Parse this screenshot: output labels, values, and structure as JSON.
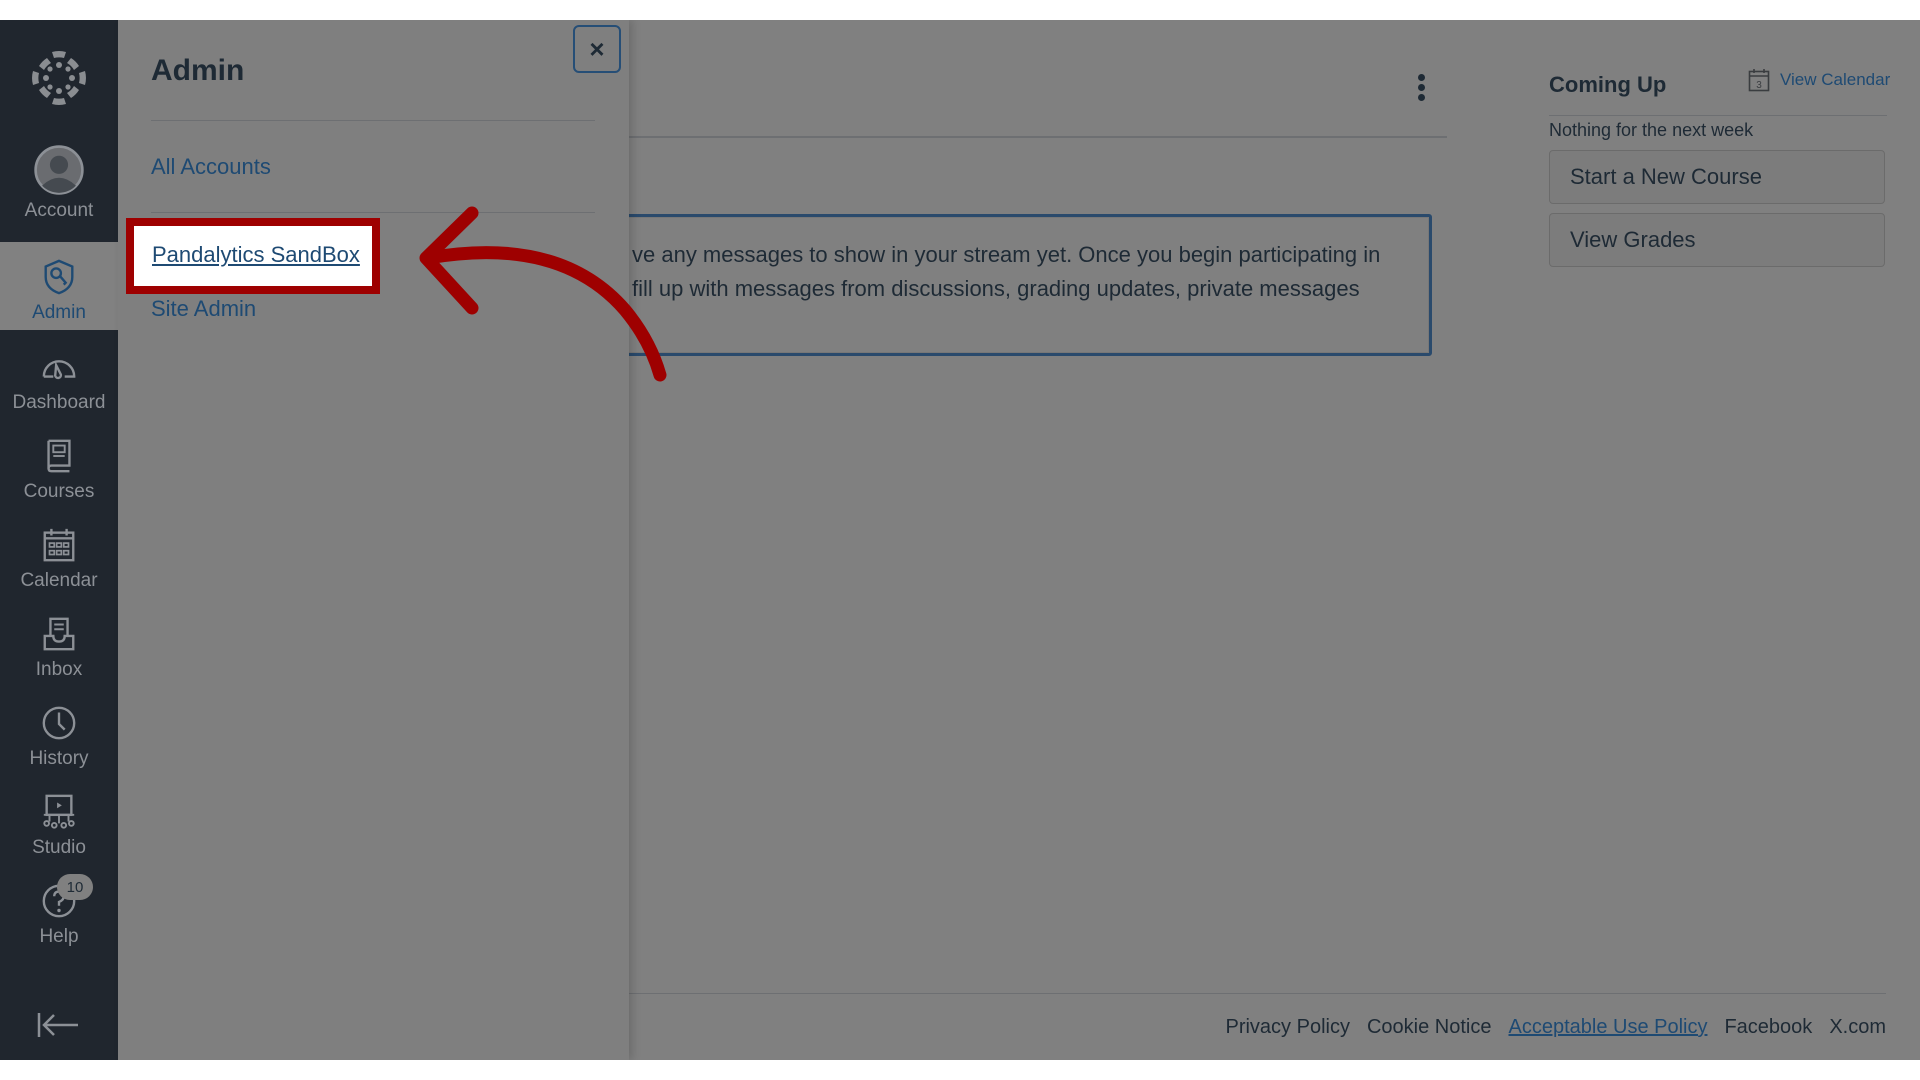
{
  "global_nav": {
    "items": [
      {
        "label": "Account",
        "icon": "user-avatar-icon"
      },
      {
        "label": "Admin",
        "icon": "shield-key-icon",
        "active": true
      },
      {
        "label": "Dashboard",
        "icon": "speedometer-icon"
      },
      {
        "label": "Courses",
        "icon": "book-icon"
      },
      {
        "label": "Calendar",
        "icon": "calendar-icon"
      },
      {
        "label": "Inbox",
        "icon": "inbox-icon"
      },
      {
        "label": "History",
        "icon": "clock-icon"
      },
      {
        "label": "Studio",
        "icon": "studio-icon"
      },
      {
        "label": "Help",
        "icon": "help-icon",
        "badge": "10"
      }
    ],
    "collapse_icon": "collapse-arrow-icon"
  },
  "admin_tray": {
    "title": "Admin",
    "close_label": "×",
    "links": [
      "All Accounts",
      "Pandalytics SandBox",
      "Site Admin"
    ],
    "highlighted_link": "Pandalytics SandBox"
  },
  "stream": {
    "line1": "ve any messages to show in your stream yet. Once you begin participating in",
    "line2": "fill up with messages from discussions, grading updates, private messages"
  },
  "coming_up": {
    "title": "Coming Up",
    "view_calendar": "View Calendar",
    "calendar_day": "3",
    "empty_text": "Nothing for the next week"
  },
  "sidebar_buttons": [
    "Start a New Course",
    "View Grades"
  ],
  "footer": {
    "links": [
      "Privacy Policy",
      "Cookie Notice",
      "Acceptable Use Policy",
      "Facebook",
      "X.com"
    ]
  },
  "colors": {
    "annotation_red": "#9e0000",
    "link_blue": "#1e4a73",
    "nav_bg": "#20262e"
  }
}
